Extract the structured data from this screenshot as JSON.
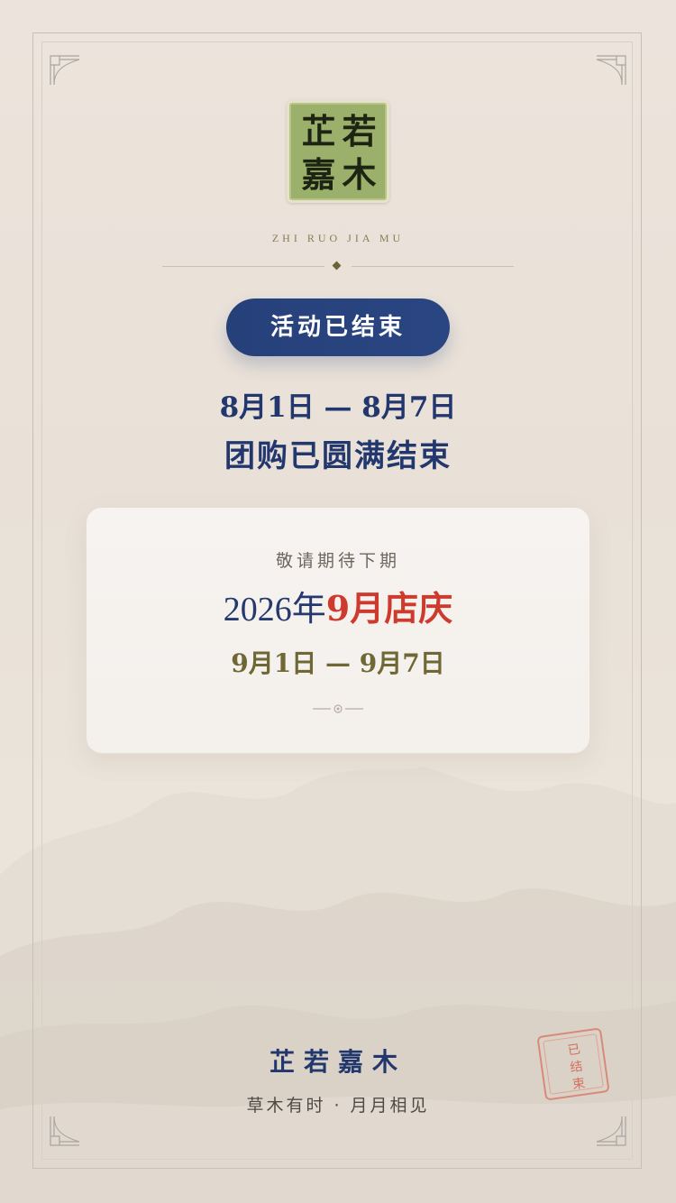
{
  "brand": {
    "logo_chars": [
      "芷",
      "若",
      "嘉",
      "木"
    ],
    "pinyin": "ZHI RUO JIA MU"
  },
  "status": {
    "pill_label": "活动已结束",
    "date_range": "8月1日 — 8月7日",
    "message": "团购已圆满结束"
  },
  "next_event": {
    "subtitle": "敬请期待下期",
    "year": "2026年",
    "name": "9月店庆",
    "dates": "9月1日 — 9月7日"
  },
  "footer": {
    "brand": "芷若嘉木",
    "slogan": "草木有时 · 月月相见"
  },
  "stamp": {
    "lines": [
      "已",
      "结",
      "束"
    ]
  },
  "colors": {
    "navy": "#22376e",
    "accent_red": "#cd3b2f",
    "olive": "#6f6834",
    "seal_green": "#9bb06a"
  }
}
